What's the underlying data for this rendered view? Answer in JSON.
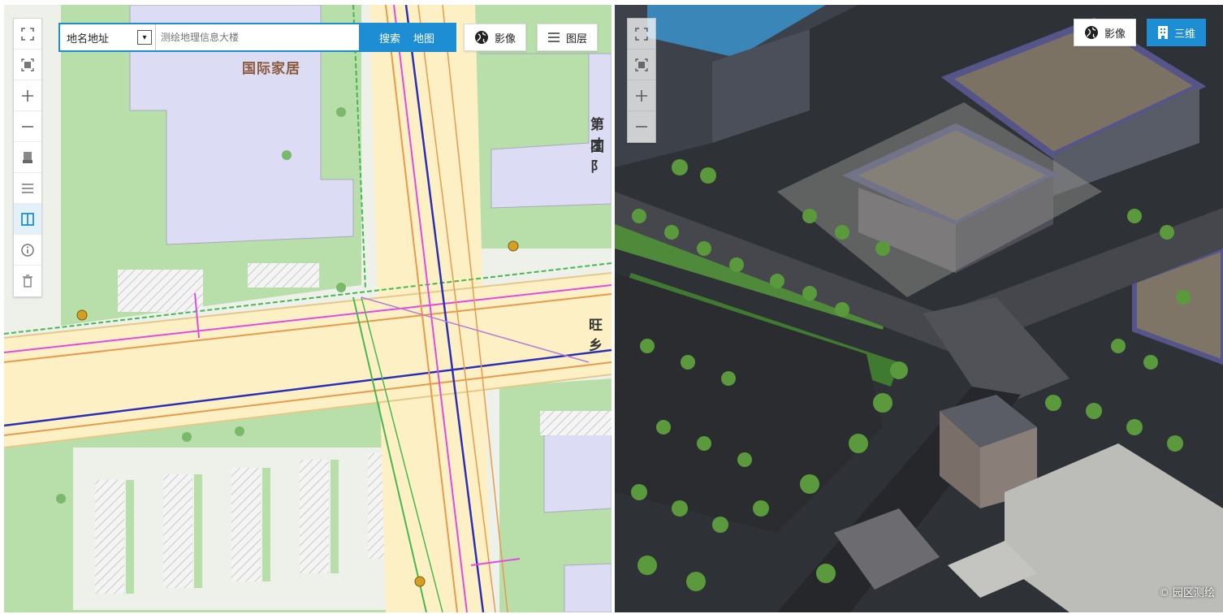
{
  "left_panel": {
    "search": {
      "category_value": "地名地址",
      "caret_glyph": "▾",
      "placeholder": "测绘地理信息大楼",
      "search_label": "搜索",
      "map_label": "地图"
    },
    "imagery_label": "影像",
    "layers_label": "图层",
    "map_labels": {
      "building": "国际家居",
      "right_top_1": "第 才",
      "right_top_2": "国 阝",
      "street": "旺 乡"
    },
    "toolbar": [
      "fullscreen-icon",
      "locate-icon",
      "zoom-in-icon",
      "zoom-out-icon",
      "print-icon",
      "measure-icon",
      "split-view-icon",
      "info-icon",
      "delete-icon"
    ]
  },
  "right_panel": {
    "imagery_label": "影像",
    "threed_label": "三维",
    "watermark": "© 园区测绘",
    "toolbar": [
      "fullscreen-icon",
      "locate-icon",
      "zoom-in-icon",
      "zoom-out-icon"
    ]
  },
  "colors": {
    "accent": "#1e8ed4",
    "map_background": "#eef0ea",
    "road_fill": "#fdf0c4",
    "green_space": "#b8deaa",
    "building": "#dcdcf4",
    "pipeline_magenta": "#e04ce0",
    "pipeline_blue": "#2b2fb4",
    "pipeline_orange": "#e89a4c",
    "pipeline_green": "#46b850"
  }
}
